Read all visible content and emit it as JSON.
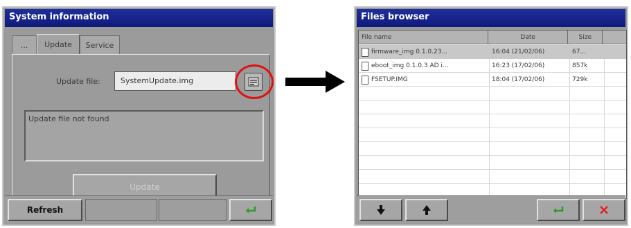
{
  "left_window": {
    "title": "System information",
    "tabs": [
      {
        "label": "..."
      },
      {
        "label": "Update"
      },
      {
        "label": "Service"
      }
    ],
    "update_file_label": "Update file:",
    "update_file_value": "SystemUpdate.img",
    "message": "Update file not found",
    "update_button": "Update",
    "refresh_button": "Refresh",
    "enter_icon": "enter-icon",
    "browse_icon": "browse-icon"
  },
  "arrow_icon": "right-arrow-icon",
  "right_window": {
    "title": "Files browser",
    "columns": [
      "File name",
      "Date",
      "Size"
    ],
    "rows": [
      {
        "name": "firmware_img 0.1.0.23...",
        "date": "16:04 (21/02/06)",
        "size": "67..."
      },
      {
        "name": "eboot_img 0.1.0.3 AD i...",
        "date": "16:23 (17/02/06)",
        "size": "857k"
      },
      {
        "name": "FSETUP.IMG",
        "date": "18:04 (17/02/06)",
        "size": "729k"
      }
    ],
    "down_icon": "arrow-down-icon",
    "up_icon": "arrow-up-icon",
    "enter_icon": "enter-icon",
    "cancel_icon": "close-icon",
    "colors": {
      "enter": "#2a9a2a",
      "cancel": "#e02020",
      "highlight": "#e01010"
    }
  }
}
